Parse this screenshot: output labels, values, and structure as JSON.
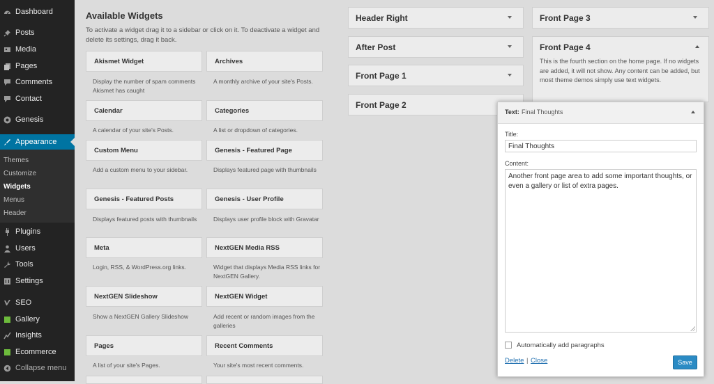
{
  "sidebar": {
    "items": [
      {
        "label": "Dashboard",
        "icon": "dashboard-icon"
      },
      {
        "label": "Posts",
        "icon": "pin-icon"
      },
      {
        "label": "Media",
        "icon": "media-icon"
      },
      {
        "label": "Pages",
        "icon": "pages-icon"
      },
      {
        "label": "Comments",
        "icon": "comment-icon"
      },
      {
        "label": "Contact",
        "icon": "contact-icon"
      },
      {
        "label": "Genesis",
        "icon": "genesis-icon"
      },
      {
        "label": "Appearance",
        "icon": "brush-icon"
      },
      {
        "label": "Plugins",
        "icon": "plug-icon"
      },
      {
        "label": "Users",
        "icon": "user-icon"
      },
      {
        "label": "Tools",
        "icon": "wrench-icon"
      },
      {
        "label": "Settings",
        "icon": "sliders-icon"
      },
      {
        "label": "SEO",
        "icon": "seo-icon"
      },
      {
        "label": "Gallery",
        "icon": "gallery-icon"
      },
      {
        "label": "Insights",
        "icon": "insights-icon"
      },
      {
        "label": "Ecommerce",
        "icon": "ecommerce-icon"
      },
      {
        "label": "Collapse menu",
        "icon": "collapse-icon"
      }
    ],
    "submenu": [
      "Themes",
      "Customize",
      "Widgets",
      "Menus",
      "Header"
    ],
    "active_color": "#0074a2"
  },
  "available": {
    "title": "Available Widgets",
    "description": "To activate a widget drag it to a sidebar or click on it. To deactivate a widget and delete its settings, drag it back.",
    "widgets": [
      {
        "name": "Akismet Widget",
        "desc": "Display the number of spam comments Akismet has caught"
      },
      {
        "name": "Archives",
        "desc": "A monthly archive of your site's Posts."
      },
      {
        "name": "Calendar",
        "desc": "A calendar of your site's Posts."
      },
      {
        "name": "Categories",
        "desc": "A list or dropdown of categories."
      },
      {
        "name": "Custom Menu",
        "desc": "Add a custom menu to your sidebar."
      },
      {
        "name": "Genesis - Featured Page",
        "desc": "Displays featured page with thumbnails"
      },
      {
        "name": "Genesis - Featured Posts",
        "desc": "Displays featured posts with thumbnails"
      },
      {
        "name": "Genesis - User Profile",
        "desc": "Displays user profile block with Gravatar"
      },
      {
        "name": "Meta",
        "desc": "Login, RSS, & WordPress.org links."
      },
      {
        "name": "NextGEN Media RSS",
        "desc": "Widget that displays Media RSS links for NextGEN Gallery."
      },
      {
        "name": "NextGEN Slideshow",
        "desc": "Show a NextGEN Gallery Slideshow"
      },
      {
        "name": "NextGEN Widget",
        "desc": "Add recent or random images from the galleries"
      },
      {
        "name": "Pages",
        "desc": "A list of your site's Pages."
      },
      {
        "name": "Recent Comments",
        "desc": "Your site's most recent comments."
      }
    ]
  },
  "areas": {
    "col1": [
      "Header Right",
      "After Post",
      "Front Page 1",
      "Front Page 2"
    ],
    "col2": [
      "Front Page 3"
    ],
    "front_page_4": {
      "title": "Front Page 4",
      "description": "This is the fourth section on the home page. If no widgets are added, it will not show. Any content can be added, but most theme demos simply use text widgets."
    }
  },
  "text_widget": {
    "type": "Text:",
    "name": "Final Thoughts",
    "title_label": "Title:",
    "title_value": "Final Thoughts",
    "content_label": "Content:",
    "content_value": "Another front page area to add some important thoughts, or even a gallery or list of extra pages.",
    "auto_paragraphs_label": "Automatically add paragraphs",
    "auto_paragraphs_checked": false,
    "delete_label": "Delete",
    "separator": "|",
    "close_label": "Close",
    "save_label": "Save"
  }
}
